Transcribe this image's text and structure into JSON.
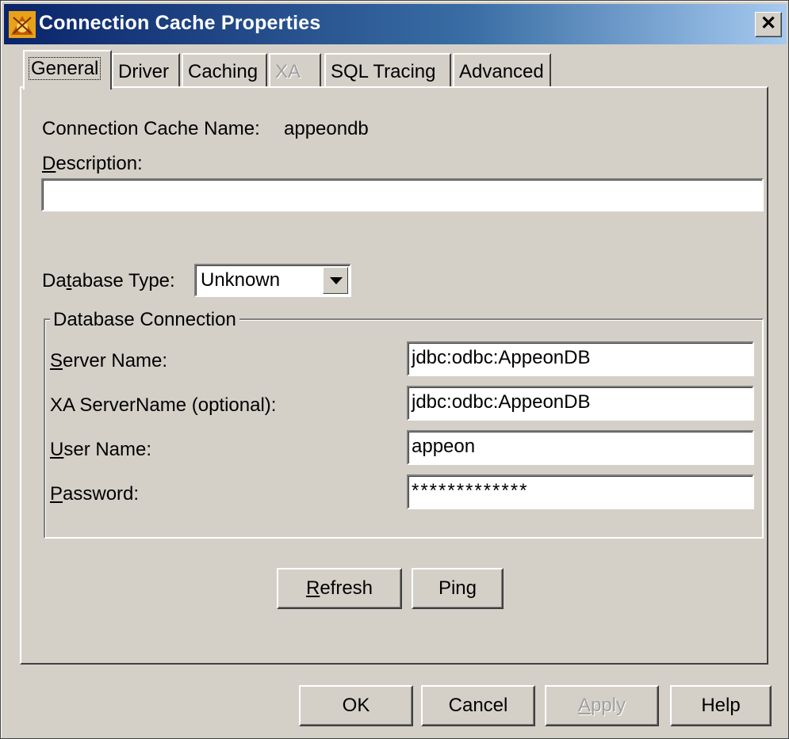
{
  "window": {
    "title": "Connection Cache Properties"
  },
  "tabs": [
    {
      "label": "General",
      "active": true,
      "enabled": true
    },
    {
      "label": "Driver",
      "active": false,
      "enabled": true
    },
    {
      "label": "Caching",
      "active": false,
      "enabled": true
    },
    {
      "label": "XA",
      "active": false,
      "enabled": false
    },
    {
      "label": "SQL Tracing",
      "active": false,
      "enabled": true
    },
    {
      "label": "Advanced",
      "active": false,
      "enabled": true
    }
  ],
  "general": {
    "cache_name_label": "Connection Cache Name:",
    "cache_name_value": "appeondb",
    "description_label_mnemonic": "D",
    "description_label_rest": "escription:",
    "description_value": "",
    "db_type_label_pre": "Da",
    "db_type_label_mnemonic": "t",
    "db_type_label_post": "abase Type:",
    "db_type_value": "Unknown",
    "connection_group_label": "Database Connection",
    "server_name_label_mnemonic": "S",
    "server_name_label_rest": "erver Name:",
    "server_name_value": "jdbc:odbc:AppeonDB",
    "xa_server_name_label": "XA ServerName (optional):",
    "xa_server_name_value": "jdbc:odbc:AppeonDB",
    "user_name_label_mnemonic": "U",
    "user_name_label_rest": "ser Name:",
    "user_name_value": "appeon",
    "password_label_mnemonic": "P",
    "password_label_rest": "assword:",
    "password_value": "*************",
    "refresh_mnemonic": "R",
    "refresh_rest": "efresh",
    "ping_pre": "Pin",
    "ping_mnemonic": "g"
  },
  "footer": {
    "ok_label": "OK",
    "cancel_label": "Cancel",
    "apply_mnemonic": "A",
    "apply_rest": "pply",
    "help_label": "Help"
  },
  "colors": {
    "title_gradient_start": "#0a246a",
    "title_gradient_end": "#a6caf0",
    "face": "#d4d0c8",
    "disabled_text": "#a0a0a0"
  }
}
